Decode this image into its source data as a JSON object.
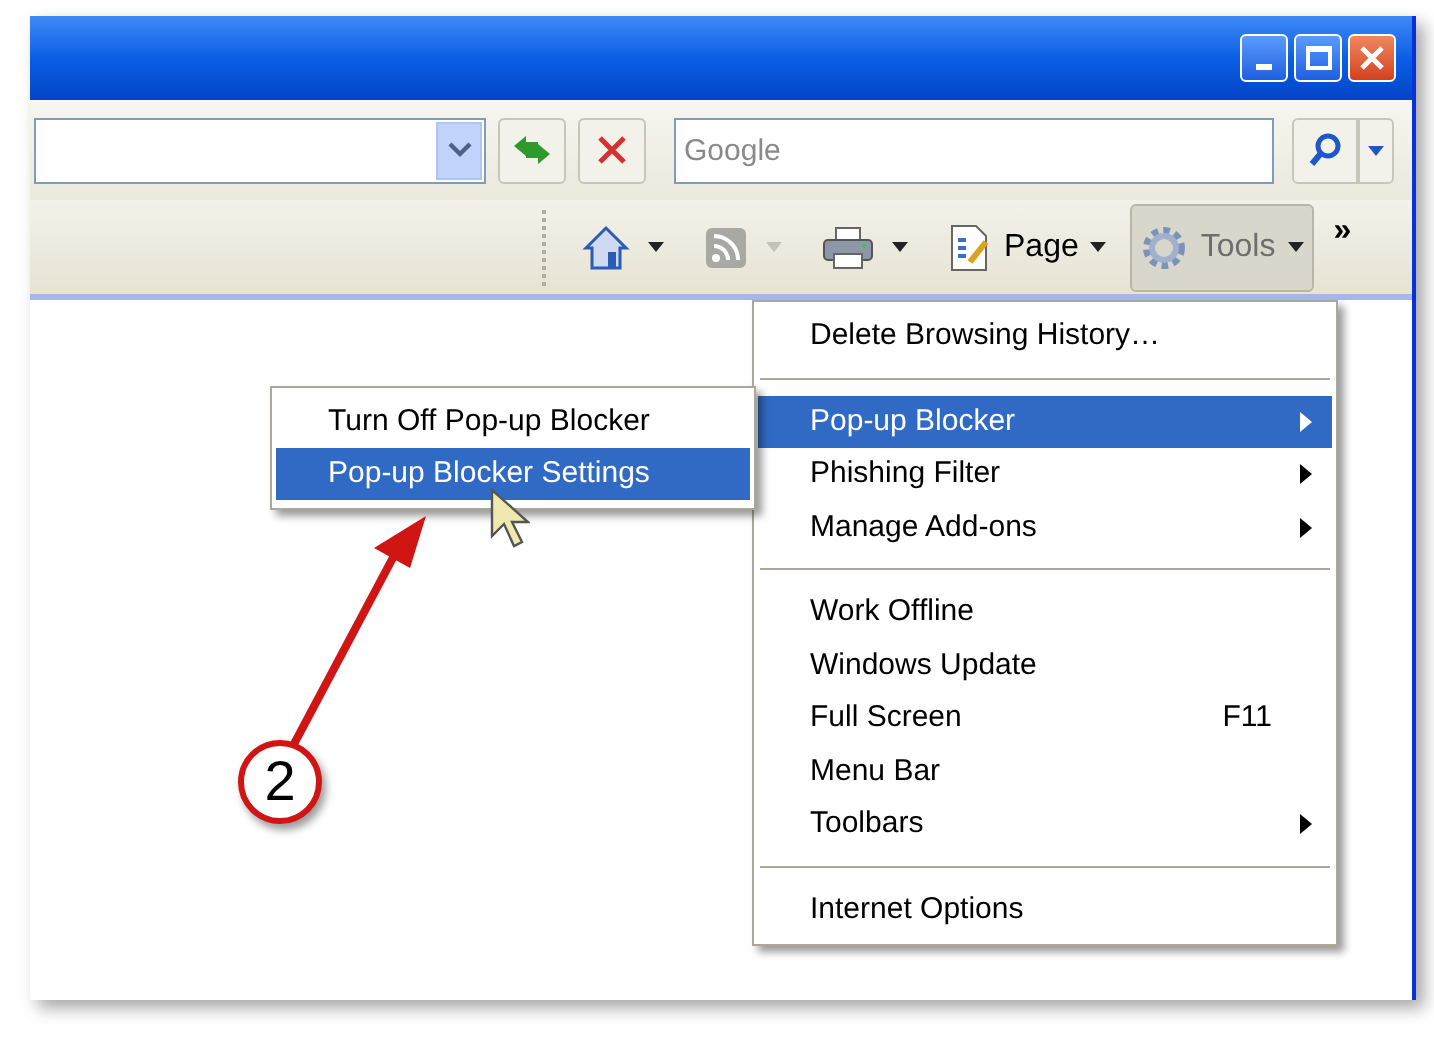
{
  "search": {
    "placeholder": "Google"
  },
  "command_bar": {
    "items": [
      {
        "kind": "home",
        "disabled": false
      },
      {
        "kind": "feeds",
        "disabled": true
      },
      {
        "kind": "print",
        "disabled": false
      },
      {
        "kind": "page",
        "label": "Page",
        "disabled": false
      },
      {
        "kind": "tools",
        "label": "Tools",
        "disabled": false
      }
    ],
    "chevron": "»"
  },
  "tools_menu": {
    "items": [
      {
        "kind": "item",
        "label": "Delete Browsing History…",
        "submenu": false,
        "selected": false
      },
      {
        "kind": "separator"
      },
      {
        "kind": "item",
        "label": "Pop-up Blocker",
        "submenu": true,
        "selected": true
      },
      {
        "kind": "item",
        "label": "Phishing Filter",
        "submenu": true,
        "selected": false
      },
      {
        "kind": "item",
        "label": "Manage Add-ons",
        "submenu": true,
        "selected": false
      },
      {
        "kind": "separator"
      },
      {
        "kind": "item",
        "label": "Work Offline",
        "submenu": false,
        "selected": false
      },
      {
        "kind": "item",
        "label": "Windows Update",
        "submenu": false,
        "selected": false
      },
      {
        "kind": "item",
        "label": "Full Screen",
        "shortcut": "F11",
        "submenu": false,
        "selected": false
      },
      {
        "kind": "item",
        "label": "Menu Bar",
        "submenu": false,
        "selected": false
      },
      {
        "kind": "item",
        "label": "Toolbars",
        "submenu": true,
        "selected": false
      },
      {
        "kind": "separator"
      },
      {
        "kind": "item",
        "label": "Internet Options",
        "submenu": false,
        "selected": false
      }
    ]
  },
  "popup_submenu": {
    "items": [
      {
        "label": "Turn Off Pop-up Blocker",
        "selected": false
      },
      {
        "label": "Pop-up Blocker Settings",
        "selected": true
      }
    ]
  },
  "annotation": {
    "number": "2"
  }
}
